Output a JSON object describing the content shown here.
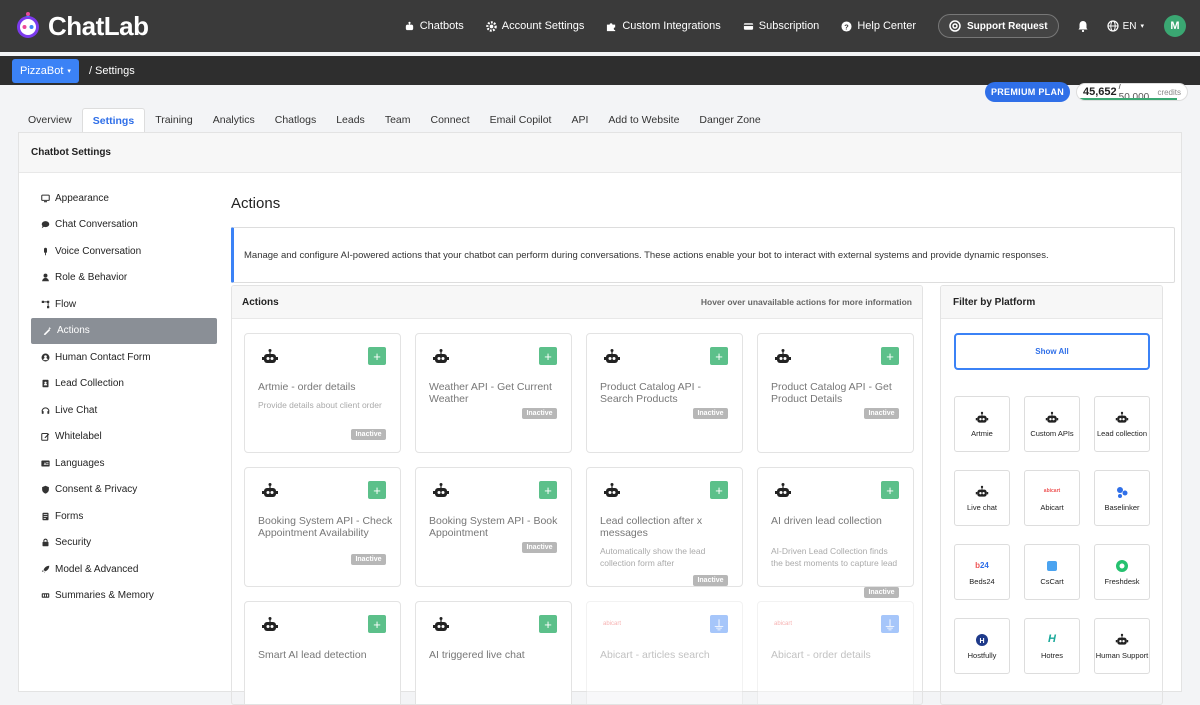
{
  "app": {
    "logo": "ChatLab"
  },
  "topnav": [
    {
      "label": "Chatbots",
      "icon": "robot-icon"
    },
    {
      "label": "Account Settings",
      "icon": "gear-icon"
    },
    {
      "label": "Custom Integrations",
      "icon": "puzzle-icon"
    },
    {
      "label": "Subscription",
      "icon": "card-icon"
    },
    {
      "label": "Help Center",
      "icon": "question-icon"
    }
  ],
  "support": {
    "label": "Support Request"
  },
  "lang": {
    "label": "EN"
  },
  "user": {
    "initial": "M"
  },
  "subbar": {
    "bot": "PizzaBot",
    "breadcrumb": "/  Settings"
  },
  "plan": {
    "label": "PREMIUM PLAN"
  },
  "credits": {
    "used": "45,652",
    "total": "/ 50,000",
    "label": "credits",
    "fraction": 0.913
  },
  "tabs": [
    "Overview",
    "Settings",
    "Training",
    "Analytics",
    "Chatlogs",
    "Leads",
    "Team",
    "Connect",
    "Email Copilot",
    "API",
    "Add to Website",
    "Danger Zone"
  ],
  "active_tab": "Settings",
  "panel": {
    "title": "Chatbot Settings"
  },
  "sidebar": [
    {
      "label": "Appearance",
      "icon": "monitor-icon"
    },
    {
      "label": "Chat Conversation",
      "icon": "comment-icon"
    },
    {
      "label": "Voice Conversation",
      "icon": "microphone-icon"
    },
    {
      "label": "Role & Behavior",
      "icon": "user-icon"
    },
    {
      "label": "Flow",
      "icon": "flow-icon"
    },
    {
      "label": "Actions",
      "icon": "magic-wand-icon"
    },
    {
      "label": "Human Contact Form",
      "icon": "user-circle-icon"
    },
    {
      "label": "Lead Collection",
      "icon": "address-book-icon"
    },
    {
      "label": "Live Chat",
      "icon": "headset-icon"
    },
    {
      "label": "Whitelabel",
      "icon": "edit-icon"
    },
    {
      "label": "Languages",
      "icon": "language-icon"
    },
    {
      "label": "Consent & Privacy",
      "icon": "shield-icon"
    },
    {
      "label": "Forms",
      "icon": "form-icon"
    },
    {
      "label": "Security",
      "icon": "lock-icon"
    },
    {
      "label": "Model & Advanced",
      "icon": "rocket-icon"
    },
    {
      "label": "Summaries & Memory",
      "icon": "memory-icon"
    }
  ],
  "active_sidebar": "Actions",
  "content": {
    "title": "Actions",
    "info": "Manage and configure AI-powered actions that your chatbot can perform during conversations. These actions enable your bot to interact with external systems and provide dynamic responses."
  },
  "actions_panel": {
    "title": "Actions",
    "hint": "Hover over unavailable actions for more information"
  },
  "actions": [
    {
      "title": "Artmie - order details",
      "desc": "Provide details about client order",
      "status": "Inactive",
      "icon": "robot-icon"
    },
    {
      "title": "Weather API - Get Current Weather",
      "desc": "",
      "status": "Inactive",
      "icon": "robot-icon"
    },
    {
      "title": "Product Catalog API - Search Products",
      "desc": "",
      "status": "Inactive",
      "icon": "robot-icon"
    },
    {
      "title": "Product Catalog API - Get Product Details",
      "desc": "",
      "status": "Inactive",
      "icon": "robot-icon"
    },
    {
      "title": "Booking System API - Check Appointment Availability",
      "desc": "",
      "status": "Inactive",
      "icon": "robot-icon"
    },
    {
      "title": "Booking System API - Book Appointment",
      "desc": "",
      "status": "Inactive",
      "icon": "robot-icon"
    },
    {
      "title": "Lead collection after x messages",
      "desc": "Automatically show the lead collection form after",
      "status": "Inactive",
      "icon": "robot-icon"
    },
    {
      "title": "AI driven lead collection",
      "desc": "AI-Driven Lead Collection finds the best moments to capture lead",
      "status": "Inactive",
      "icon": "robot-icon"
    },
    {
      "title": "Smart AI lead detection",
      "desc": "",
      "status": "",
      "icon": "robot-icon"
    },
    {
      "title": "AI triggered live chat",
      "desc": "",
      "status": "",
      "icon": "robot-icon"
    },
    {
      "title": "Abicart - articles search",
      "desc": "",
      "status": "",
      "icon": "abicart-icon",
      "locked": true
    },
    {
      "title": "Abicart - order details",
      "desc": "",
      "status": "",
      "icon": "abicart-icon",
      "locked": true
    }
  ],
  "filter": {
    "title": "Filter by Platform",
    "show_all": "Show All",
    "platforms": [
      {
        "label": "Artmie",
        "icon": "robot-icon"
      },
      {
        "label": "Custom APIs",
        "icon": "robot-icon"
      },
      {
        "label": "Lead collection",
        "icon": "robot-icon"
      },
      {
        "label": "Live chat",
        "icon": "robot-icon"
      },
      {
        "label": "Abicart",
        "icon": "abicart-icon"
      },
      {
        "label": "Baselinker",
        "icon": "baselinker-icon"
      },
      {
        "label": "Beds24",
        "icon": "beds24-icon"
      },
      {
        "label": "CsCart",
        "icon": "cscart-icon"
      },
      {
        "label": "Freshdesk",
        "icon": "freshdesk-icon"
      },
      {
        "label": "Hostfully",
        "icon": "hostfully-icon"
      },
      {
        "label": "Hotres",
        "icon": "hotres-icon"
      },
      {
        "label": "Human Support",
        "icon": "robot-icon"
      }
    ]
  },
  "colors": {
    "accent": "#3b82f6",
    "add": "#5cc08a",
    "highlight": "#e11111",
    "topbar": "#3a3a3a"
  }
}
